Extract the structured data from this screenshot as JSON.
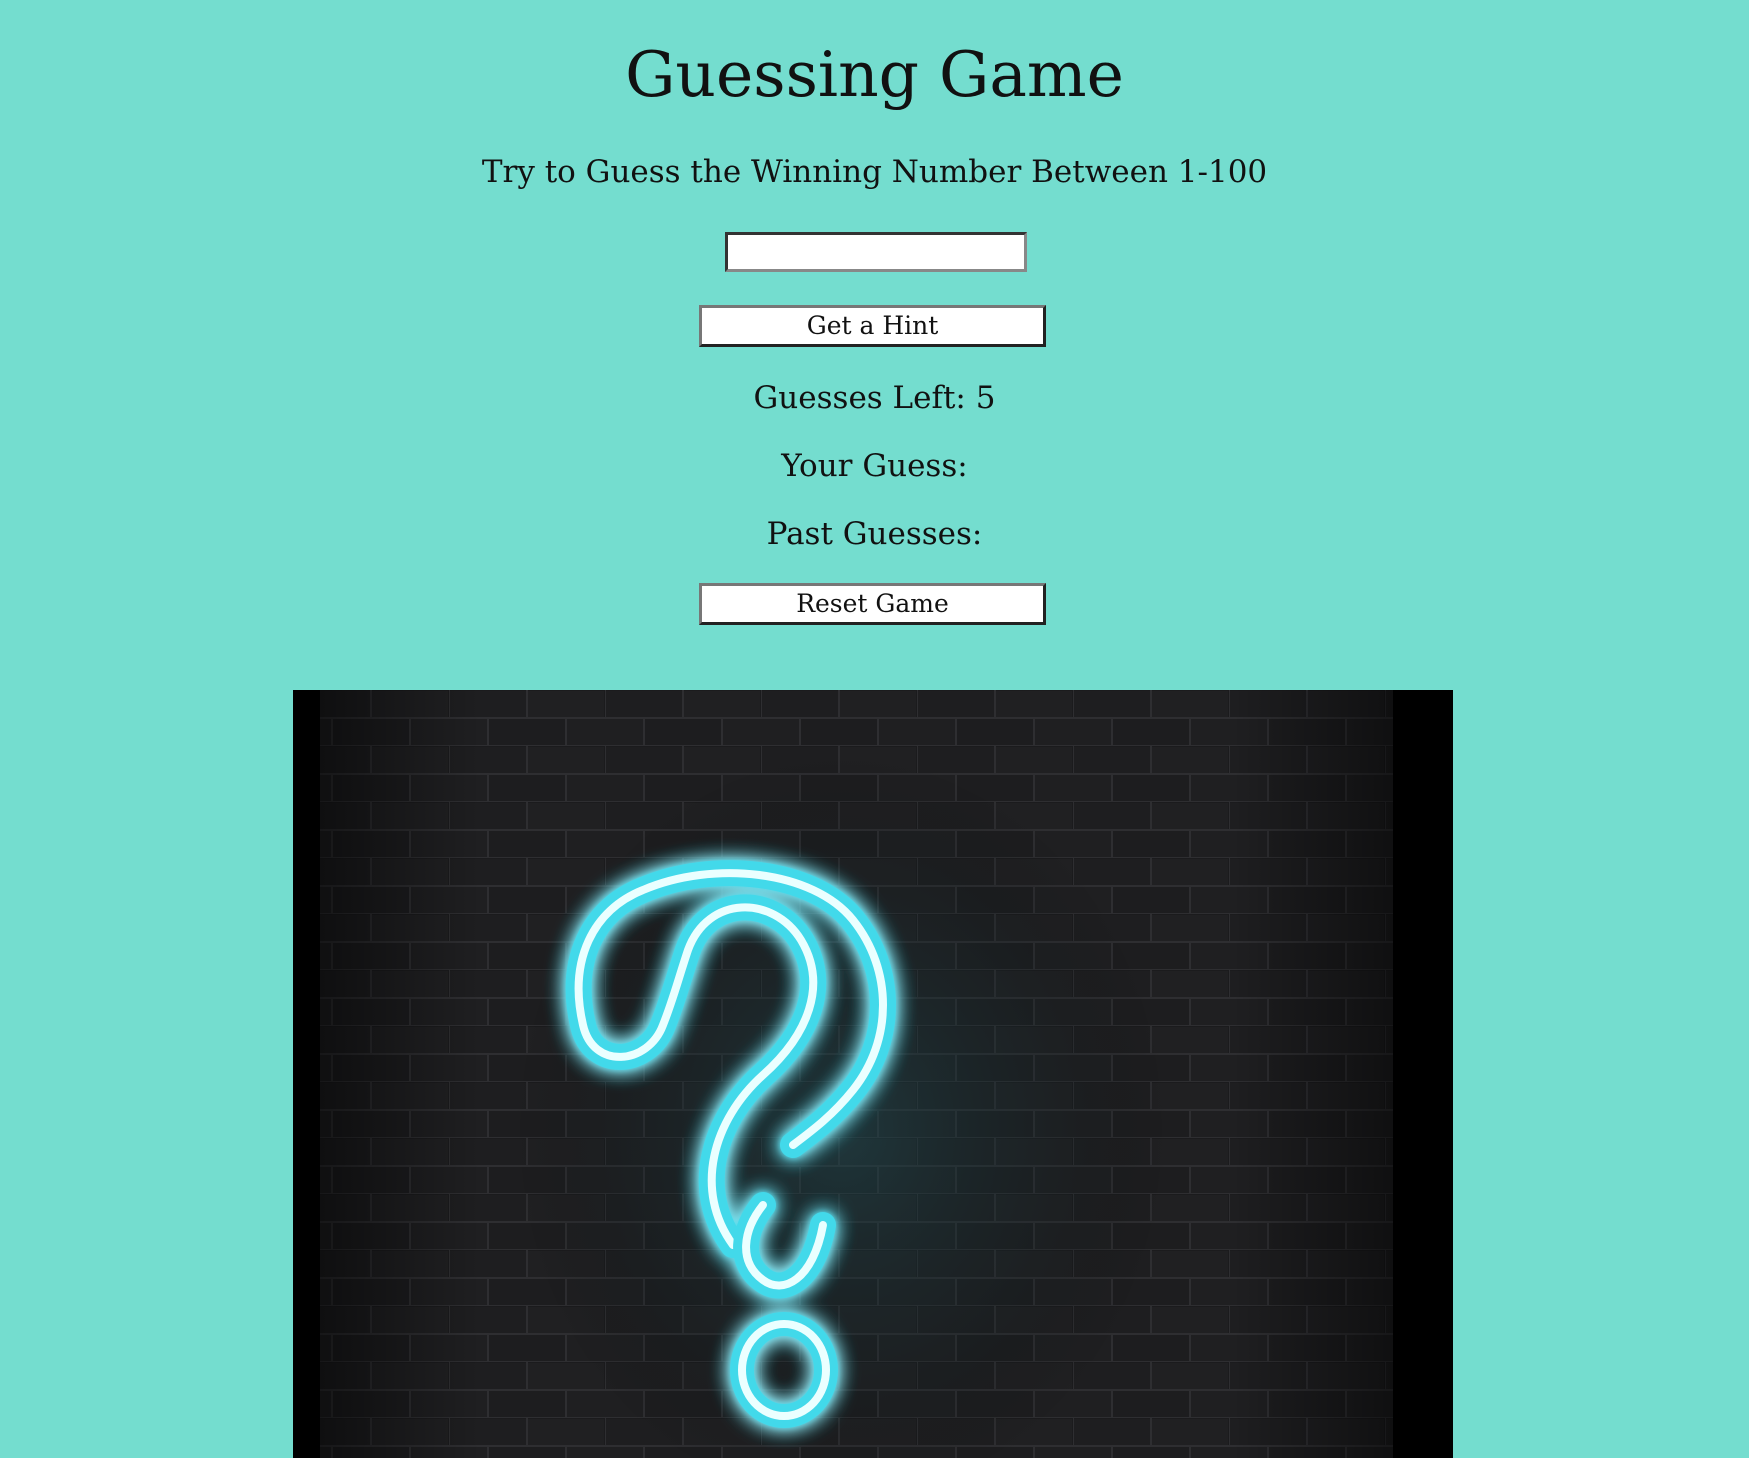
{
  "page": {
    "title": "Guessing Game",
    "subtitle": "Try to Guess the Winning Number Between 1-100"
  },
  "form": {
    "guess_input_value": "",
    "guess_input_placeholder": "",
    "hint_button_label": "Get a Hint",
    "reset_button_label": "Reset Game"
  },
  "status": {
    "guesses_left_label": "Guesses Left: 5",
    "your_guess_label": "Your Guess:",
    "past_guesses_label": "Past Guesses:"
  },
  "image": {
    "icon": "neon-question-mark-icon",
    "description_colors": {
      "background": "#74ddcf",
      "brick_wall": "#1c1c1e",
      "neon": "#5fe9f5"
    }
  }
}
